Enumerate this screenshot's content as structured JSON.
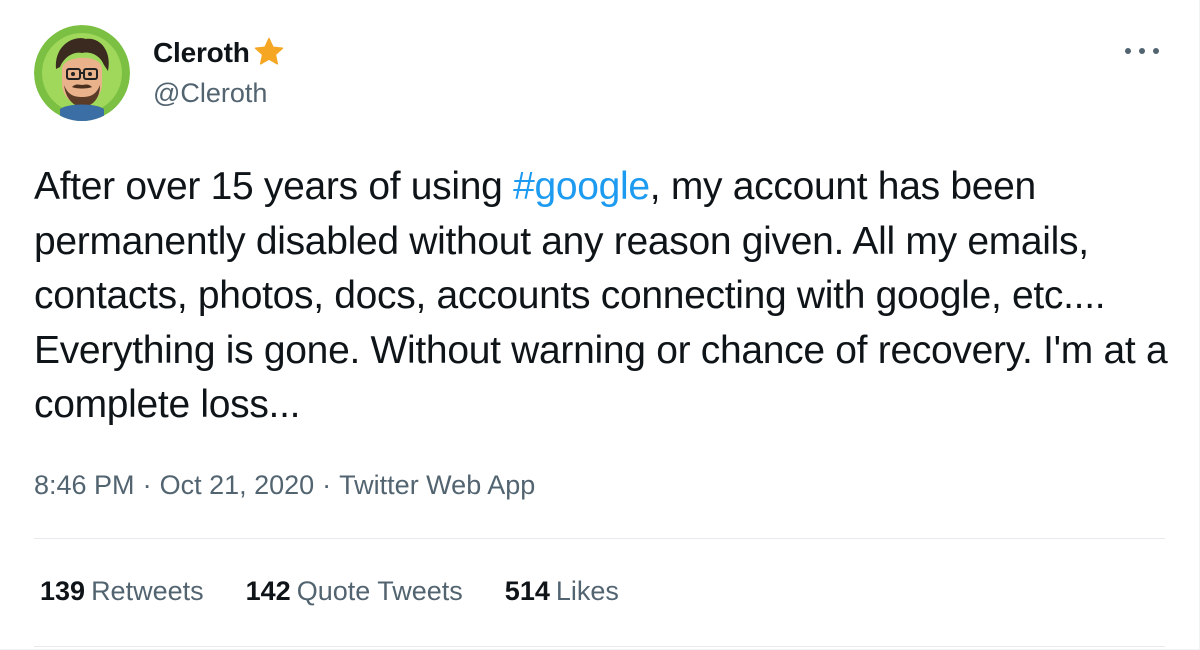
{
  "user": {
    "display_name": "Cleroth",
    "handle": "@Cleroth",
    "badge_icon": "star-icon",
    "badge_color": "#f5a623",
    "avatar_bg": "#7bc043"
  },
  "tweet": {
    "text_before": "After over 15 years of using ",
    "hashtag": "#google",
    "text_after": ", my account has been permanently disabled without any reason given. All my emails, contacts, photos, docs, accounts connecting with google, etc.... Everything is gone. Without warning or chance of recovery. I'm at a complete loss...",
    "time": "8:46 PM",
    "separator": "·",
    "date": "Oct 21, 2020",
    "source": "Twitter Web App"
  },
  "stats": {
    "retweets": {
      "count": "139",
      "label": "Retweets"
    },
    "quotes": {
      "count": "142",
      "label": "Quote Tweets"
    },
    "likes": {
      "count": "514",
      "label": "Likes"
    }
  },
  "colors": {
    "link": "#1d9bf0",
    "secondary_text": "#536471",
    "primary_text": "#0f1419"
  },
  "icons": {
    "more": "more-icon"
  }
}
